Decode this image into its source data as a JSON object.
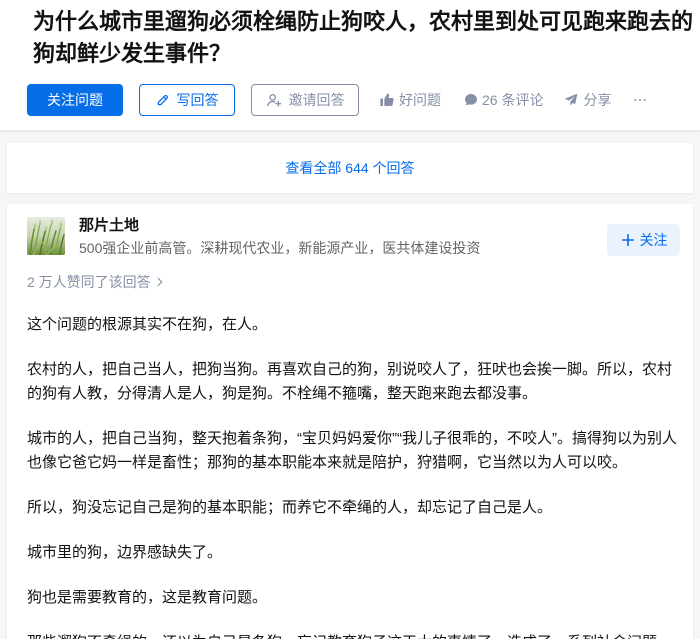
{
  "question": {
    "title": "为什么城市里遛狗必须栓绳防止狗咬人，农村里到处可见跑来跑去的狗却鲜少发生事件？",
    "actions": {
      "follow_label": "关注问题",
      "write_label": "写回答",
      "invite_label": "邀请回答",
      "good_question_label": "好问题",
      "comments_label": "26 条评论",
      "share_label": "分享"
    }
  },
  "view_all": {
    "label": "查看全部 644 个回答"
  },
  "answer": {
    "author": {
      "name": "那片土地",
      "bio": "500强企业前高管。深耕现代农业，新能源产业，医共体建设投资",
      "follow_label": "关注"
    },
    "votes_text": "2 万人赞同了该回答",
    "paragraphs": [
      "这个问题的根源其实不在狗，在人。",
      "农村的人，把自己当人，把狗当狗。再喜欢自己的狗，别说咬人了，狂吠也会挨一脚。所以，农村的狗有人教，分得清人是人，狗是狗。不栓绳不箍嘴，整天跑来跑去都没事。",
      "城市的人，把自己当狗，整天抱着条狗，“宝贝妈妈爱你”“我儿子很乖的，不咬人”。搞得狗以为别人也像它爸它妈一样是畜性；那狗的基本职能本来就是陪护，狩猎啊，它当然以为人可以咬。",
      "所以，狗没忘记自己是狗的基本职能；而养它不牵绳的人，却忘记了自己是人。",
      "城市里的狗，边界感缺失了。",
      "狗也是需要教育的，这是教育问题。",
      "那些遛狗不牵绳的，还以为自己是条狗，忘记教育狗子这天大的事情了，造成了一系列社会问题"
    ]
  },
  "icons": {
    "write": "pen-icon",
    "invite": "invite-user-icon",
    "good_question": "thumbs-up-icon",
    "comments": "comment-icon",
    "share": "share-icon",
    "more": "more-icon",
    "follow_author": "plus-icon",
    "votes": "chevron-right-icon"
  },
  "colors": {
    "brand": "#056de8",
    "muted": "#8590a6",
    "text": "#121212",
    "page_bg": "#f6f6f6",
    "follow_author_bg": "#e9f2fd"
  }
}
